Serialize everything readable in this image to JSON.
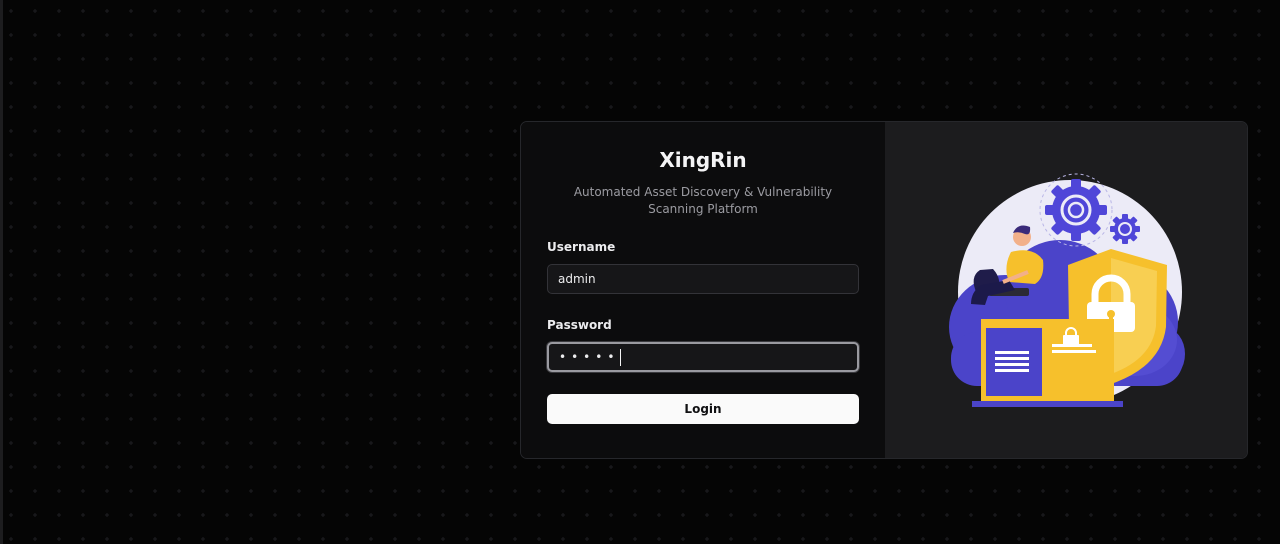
{
  "app": {
    "title": "XingRin",
    "subtitle": "Automated Asset Discovery & Vulnerability Scanning Platform"
  },
  "form": {
    "username_label": "Username",
    "username_value": "admin",
    "password_label": "Password",
    "password_value": "•••••",
    "submit_label": "Login"
  },
  "illustration": {
    "name": "security-cloud-illustration",
    "icons": [
      "gear-icon",
      "padlock-shield-icon",
      "document-icon",
      "laptop-user-figure"
    ]
  },
  "colors": {
    "background": "#050505",
    "card": "#0c0c0d",
    "art_panel": "#1c1c1e",
    "button": "#fafafa",
    "accent_blue": "#4f46d8",
    "accent_yellow": "#f6c02c"
  }
}
